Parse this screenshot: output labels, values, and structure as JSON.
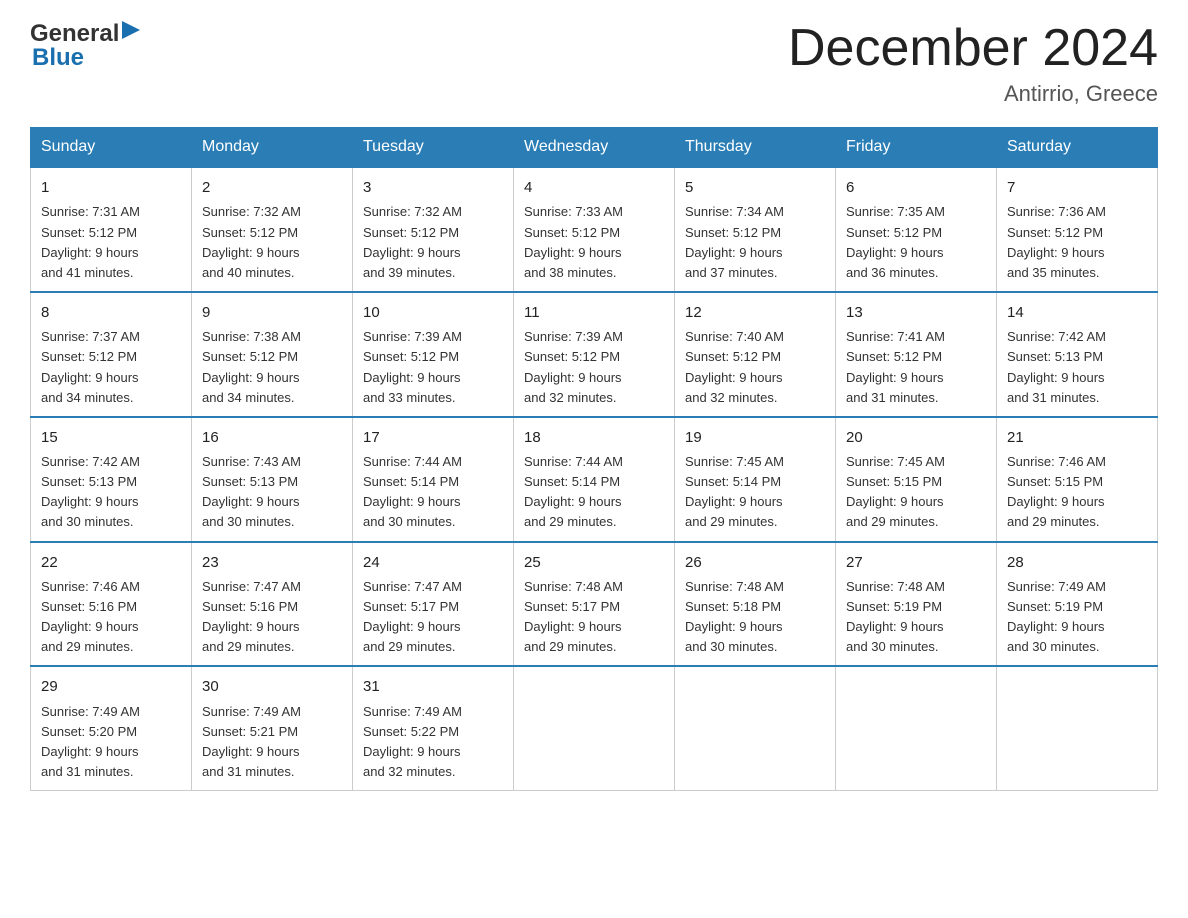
{
  "logo": {
    "general": "General",
    "arrow": "▶",
    "blue": "Blue"
  },
  "title": "December 2024",
  "subtitle": "Antirrio, Greece",
  "days_of_week": [
    "Sunday",
    "Monday",
    "Tuesday",
    "Wednesday",
    "Thursday",
    "Friday",
    "Saturday"
  ],
  "weeks": [
    [
      {
        "num": "1",
        "sunrise": "7:31 AM",
        "sunset": "5:12 PM",
        "daylight": "9 hours and 41 minutes."
      },
      {
        "num": "2",
        "sunrise": "7:32 AM",
        "sunset": "5:12 PM",
        "daylight": "9 hours and 40 minutes."
      },
      {
        "num": "3",
        "sunrise": "7:32 AM",
        "sunset": "5:12 PM",
        "daylight": "9 hours and 39 minutes."
      },
      {
        "num": "4",
        "sunrise": "7:33 AM",
        "sunset": "5:12 PM",
        "daylight": "9 hours and 38 minutes."
      },
      {
        "num": "5",
        "sunrise": "7:34 AM",
        "sunset": "5:12 PM",
        "daylight": "9 hours and 37 minutes."
      },
      {
        "num": "6",
        "sunrise": "7:35 AM",
        "sunset": "5:12 PM",
        "daylight": "9 hours and 36 minutes."
      },
      {
        "num": "7",
        "sunrise": "7:36 AM",
        "sunset": "5:12 PM",
        "daylight": "9 hours and 35 minutes."
      }
    ],
    [
      {
        "num": "8",
        "sunrise": "7:37 AM",
        "sunset": "5:12 PM",
        "daylight": "9 hours and 34 minutes."
      },
      {
        "num": "9",
        "sunrise": "7:38 AM",
        "sunset": "5:12 PM",
        "daylight": "9 hours and 34 minutes."
      },
      {
        "num": "10",
        "sunrise": "7:39 AM",
        "sunset": "5:12 PM",
        "daylight": "9 hours and 33 minutes."
      },
      {
        "num": "11",
        "sunrise": "7:39 AM",
        "sunset": "5:12 PM",
        "daylight": "9 hours and 32 minutes."
      },
      {
        "num": "12",
        "sunrise": "7:40 AM",
        "sunset": "5:12 PM",
        "daylight": "9 hours and 32 minutes."
      },
      {
        "num": "13",
        "sunrise": "7:41 AM",
        "sunset": "5:12 PM",
        "daylight": "9 hours and 31 minutes."
      },
      {
        "num": "14",
        "sunrise": "7:42 AM",
        "sunset": "5:13 PM",
        "daylight": "9 hours and 31 minutes."
      }
    ],
    [
      {
        "num": "15",
        "sunrise": "7:42 AM",
        "sunset": "5:13 PM",
        "daylight": "9 hours and 30 minutes."
      },
      {
        "num": "16",
        "sunrise": "7:43 AM",
        "sunset": "5:13 PM",
        "daylight": "9 hours and 30 minutes."
      },
      {
        "num": "17",
        "sunrise": "7:44 AM",
        "sunset": "5:14 PM",
        "daylight": "9 hours and 30 minutes."
      },
      {
        "num": "18",
        "sunrise": "7:44 AM",
        "sunset": "5:14 PM",
        "daylight": "9 hours and 29 minutes."
      },
      {
        "num": "19",
        "sunrise": "7:45 AM",
        "sunset": "5:14 PM",
        "daylight": "9 hours and 29 minutes."
      },
      {
        "num": "20",
        "sunrise": "7:45 AM",
        "sunset": "5:15 PM",
        "daylight": "9 hours and 29 minutes."
      },
      {
        "num": "21",
        "sunrise": "7:46 AM",
        "sunset": "5:15 PM",
        "daylight": "9 hours and 29 minutes."
      }
    ],
    [
      {
        "num": "22",
        "sunrise": "7:46 AM",
        "sunset": "5:16 PM",
        "daylight": "9 hours and 29 minutes."
      },
      {
        "num": "23",
        "sunrise": "7:47 AM",
        "sunset": "5:16 PM",
        "daylight": "9 hours and 29 minutes."
      },
      {
        "num": "24",
        "sunrise": "7:47 AM",
        "sunset": "5:17 PM",
        "daylight": "9 hours and 29 minutes."
      },
      {
        "num": "25",
        "sunrise": "7:48 AM",
        "sunset": "5:17 PM",
        "daylight": "9 hours and 29 minutes."
      },
      {
        "num": "26",
        "sunrise": "7:48 AM",
        "sunset": "5:18 PM",
        "daylight": "9 hours and 30 minutes."
      },
      {
        "num": "27",
        "sunrise": "7:48 AM",
        "sunset": "5:19 PM",
        "daylight": "9 hours and 30 minutes."
      },
      {
        "num": "28",
        "sunrise": "7:49 AM",
        "sunset": "5:19 PM",
        "daylight": "9 hours and 30 minutes."
      }
    ],
    [
      {
        "num": "29",
        "sunrise": "7:49 AM",
        "sunset": "5:20 PM",
        "daylight": "9 hours and 31 minutes."
      },
      {
        "num": "30",
        "sunrise": "7:49 AM",
        "sunset": "5:21 PM",
        "daylight": "9 hours and 31 minutes."
      },
      {
        "num": "31",
        "sunrise": "7:49 AM",
        "sunset": "5:22 PM",
        "daylight": "9 hours and 32 minutes."
      },
      null,
      null,
      null,
      null
    ]
  ],
  "labels": {
    "sunrise": "Sunrise:",
    "sunset": "Sunset:",
    "daylight": "Daylight:"
  }
}
